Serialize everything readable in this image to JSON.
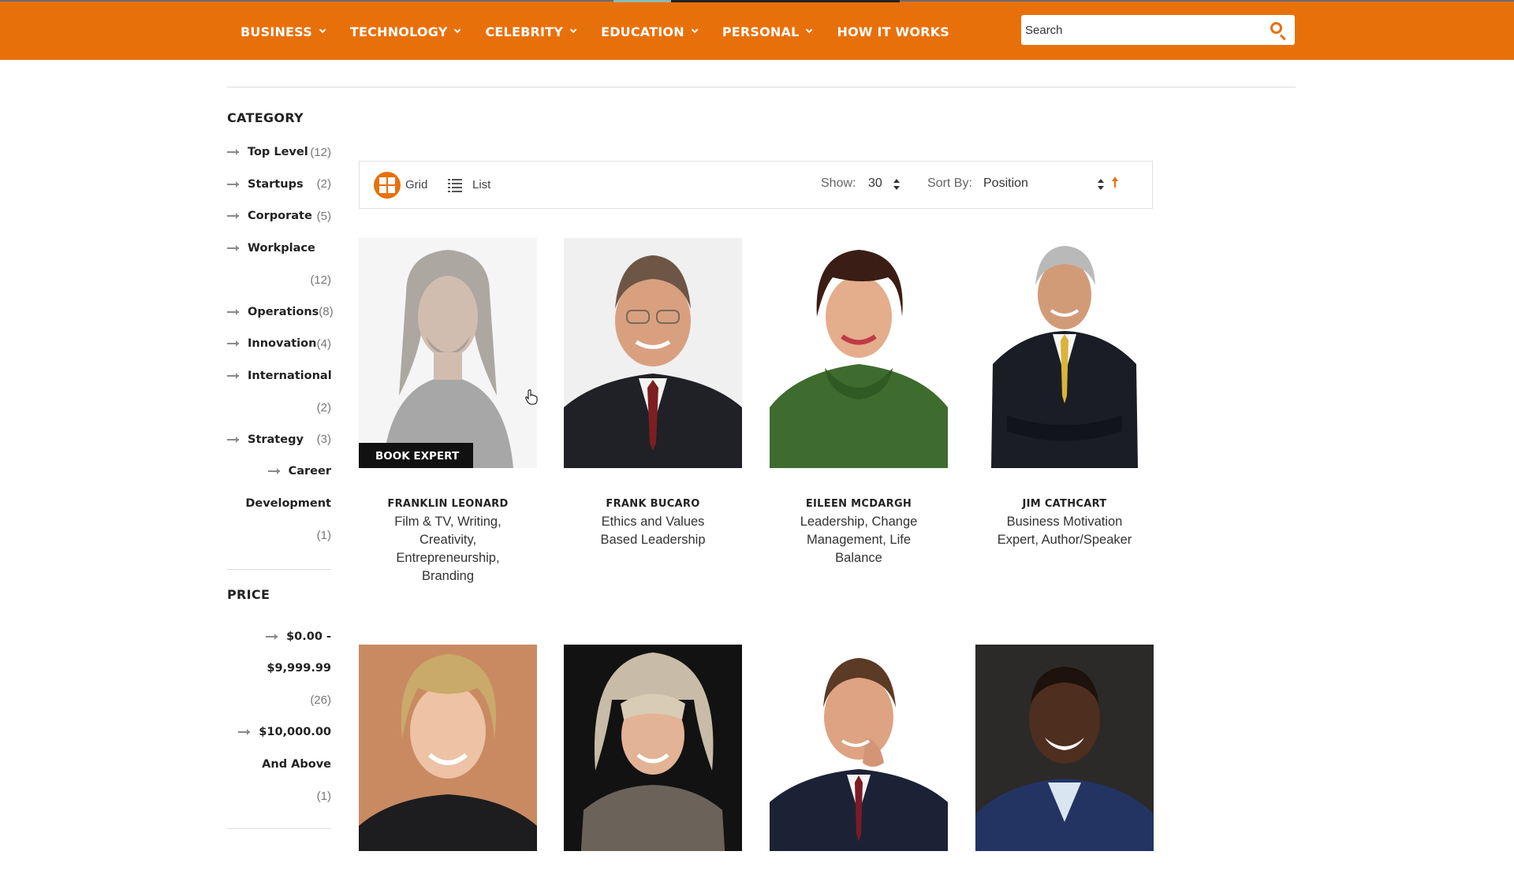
{
  "nav": {
    "items": [
      {
        "label": "BUSINESS",
        "has_dropdown": true
      },
      {
        "label": "TECHNOLOGY",
        "has_dropdown": true
      },
      {
        "label": "CELEBRITY",
        "has_dropdown": true
      },
      {
        "label": "EDUCATION",
        "has_dropdown": true
      },
      {
        "label": "PERSONAL",
        "has_dropdown": true
      },
      {
        "label": "HOW IT WORKS",
        "has_dropdown": false
      }
    ],
    "search_placeholder": "Search",
    "search_icon": "search-icon"
  },
  "sidebar": {
    "category_heading": "CATEGORY",
    "categories": [
      {
        "name": "Top Level",
        "count": "(12)"
      },
      {
        "name": "Startups",
        "count": "(2)"
      },
      {
        "name": "Corporate",
        "count": "(5)"
      },
      {
        "name": "Workplace",
        "count": "(12)"
      },
      {
        "name": "Operations",
        "count": "(8)"
      },
      {
        "name": "Innovation",
        "count": "(4)"
      },
      {
        "name": "International",
        "count": "(2)"
      },
      {
        "name": "Strategy",
        "count": "(3)"
      },
      {
        "name_line1": "Career",
        "name_line2": "Development",
        "count": "(1)"
      }
    ],
    "price_heading": "PRICE",
    "prices": [
      {
        "line1": "$0.00 -",
        "line2": "$9,999.99",
        "count": "(26)"
      },
      {
        "line1": "$10,000.00",
        "line2": "And Above",
        "count": "(1)"
      }
    ]
  },
  "toolbar": {
    "grid_label": "Grid",
    "list_label": "List",
    "show_label": "Show:",
    "show_value": "30",
    "sort_label": "Sort By:",
    "sort_value": "Position",
    "accent_color": "#e8700a"
  },
  "products": [
    {
      "name": "FRANKLIN LEONARD",
      "desc": "Film & TV, Writing, Creativity, Entrepreneurship, Branding",
      "hovered": true,
      "book_label": "BOOK EXPERT"
    },
    {
      "name": "FRANK BUCARO",
      "desc": "Ethics and Values Based Leadership"
    },
    {
      "name": "EILEEN MCDARGH",
      "desc": "Leadership, Change Management, Life Balance"
    },
    {
      "name": "JIM CATHCART",
      "desc": "Business Motivation Expert, Author/Speaker"
    },
    {
      "name": "",
      "desc": ""
    },
    {
      "name": "",
      "desc": ""
    },
    {
      "name": "",
      "desc": ""
    },
    {
      "name": "",
      "desc": ""
    }
  ],
  "colors": {
    "brand_orange": "#e8700a"
  }
}
